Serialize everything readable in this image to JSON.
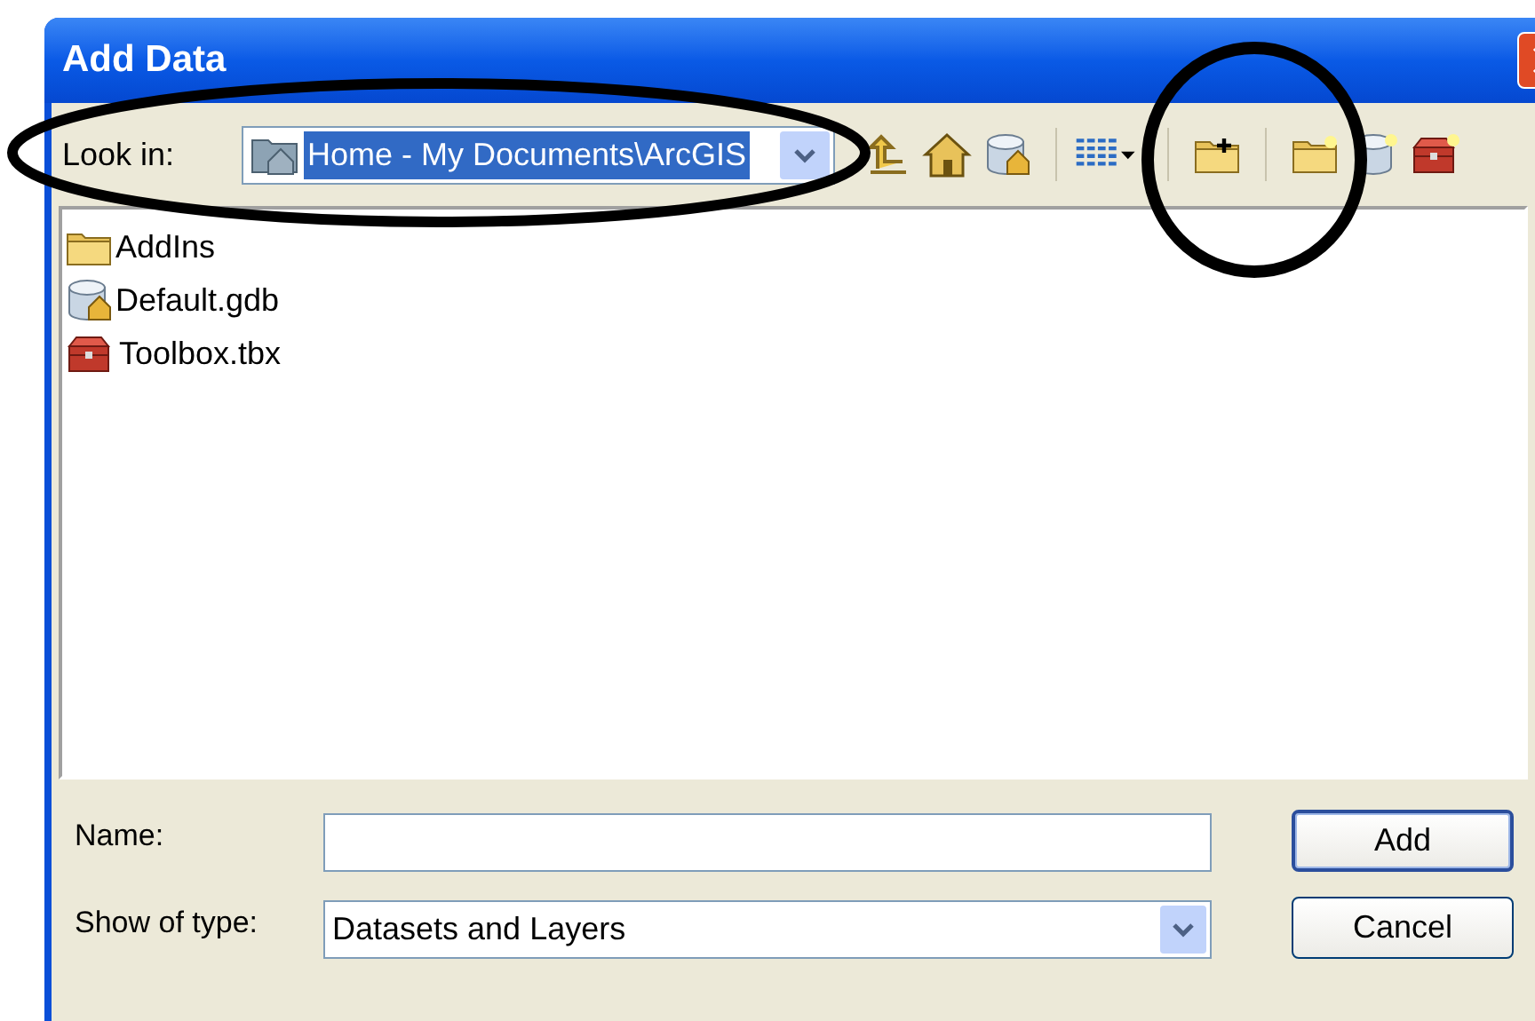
{
  "window": {
    "title": "Add Data"
  },
  "look_in": {
    "label": "Look in:",
    "value": "Home - My Documents\\ArcGIS"
  },
  "items": [
    {
      "kind": "folder",
      "name": "AddIns"
    },
    {
      "kind": "geodatabase",
      "name": "Default.gdb"
    },
    {
      "kind": "toolbox",
      "name": "Toolbox.tbx"
    }
  ],
  "name_field": {
    "label": "Name:"
  },
  "type_field": {
    "label": "Show of type:",
    "value": "Datasets and Layers"
  },
  "buttons": [
    {
      "label": "Add",
      "default": true
    },
    {
      "label": "Cancel",
      "default": false
    }
  ]
}
